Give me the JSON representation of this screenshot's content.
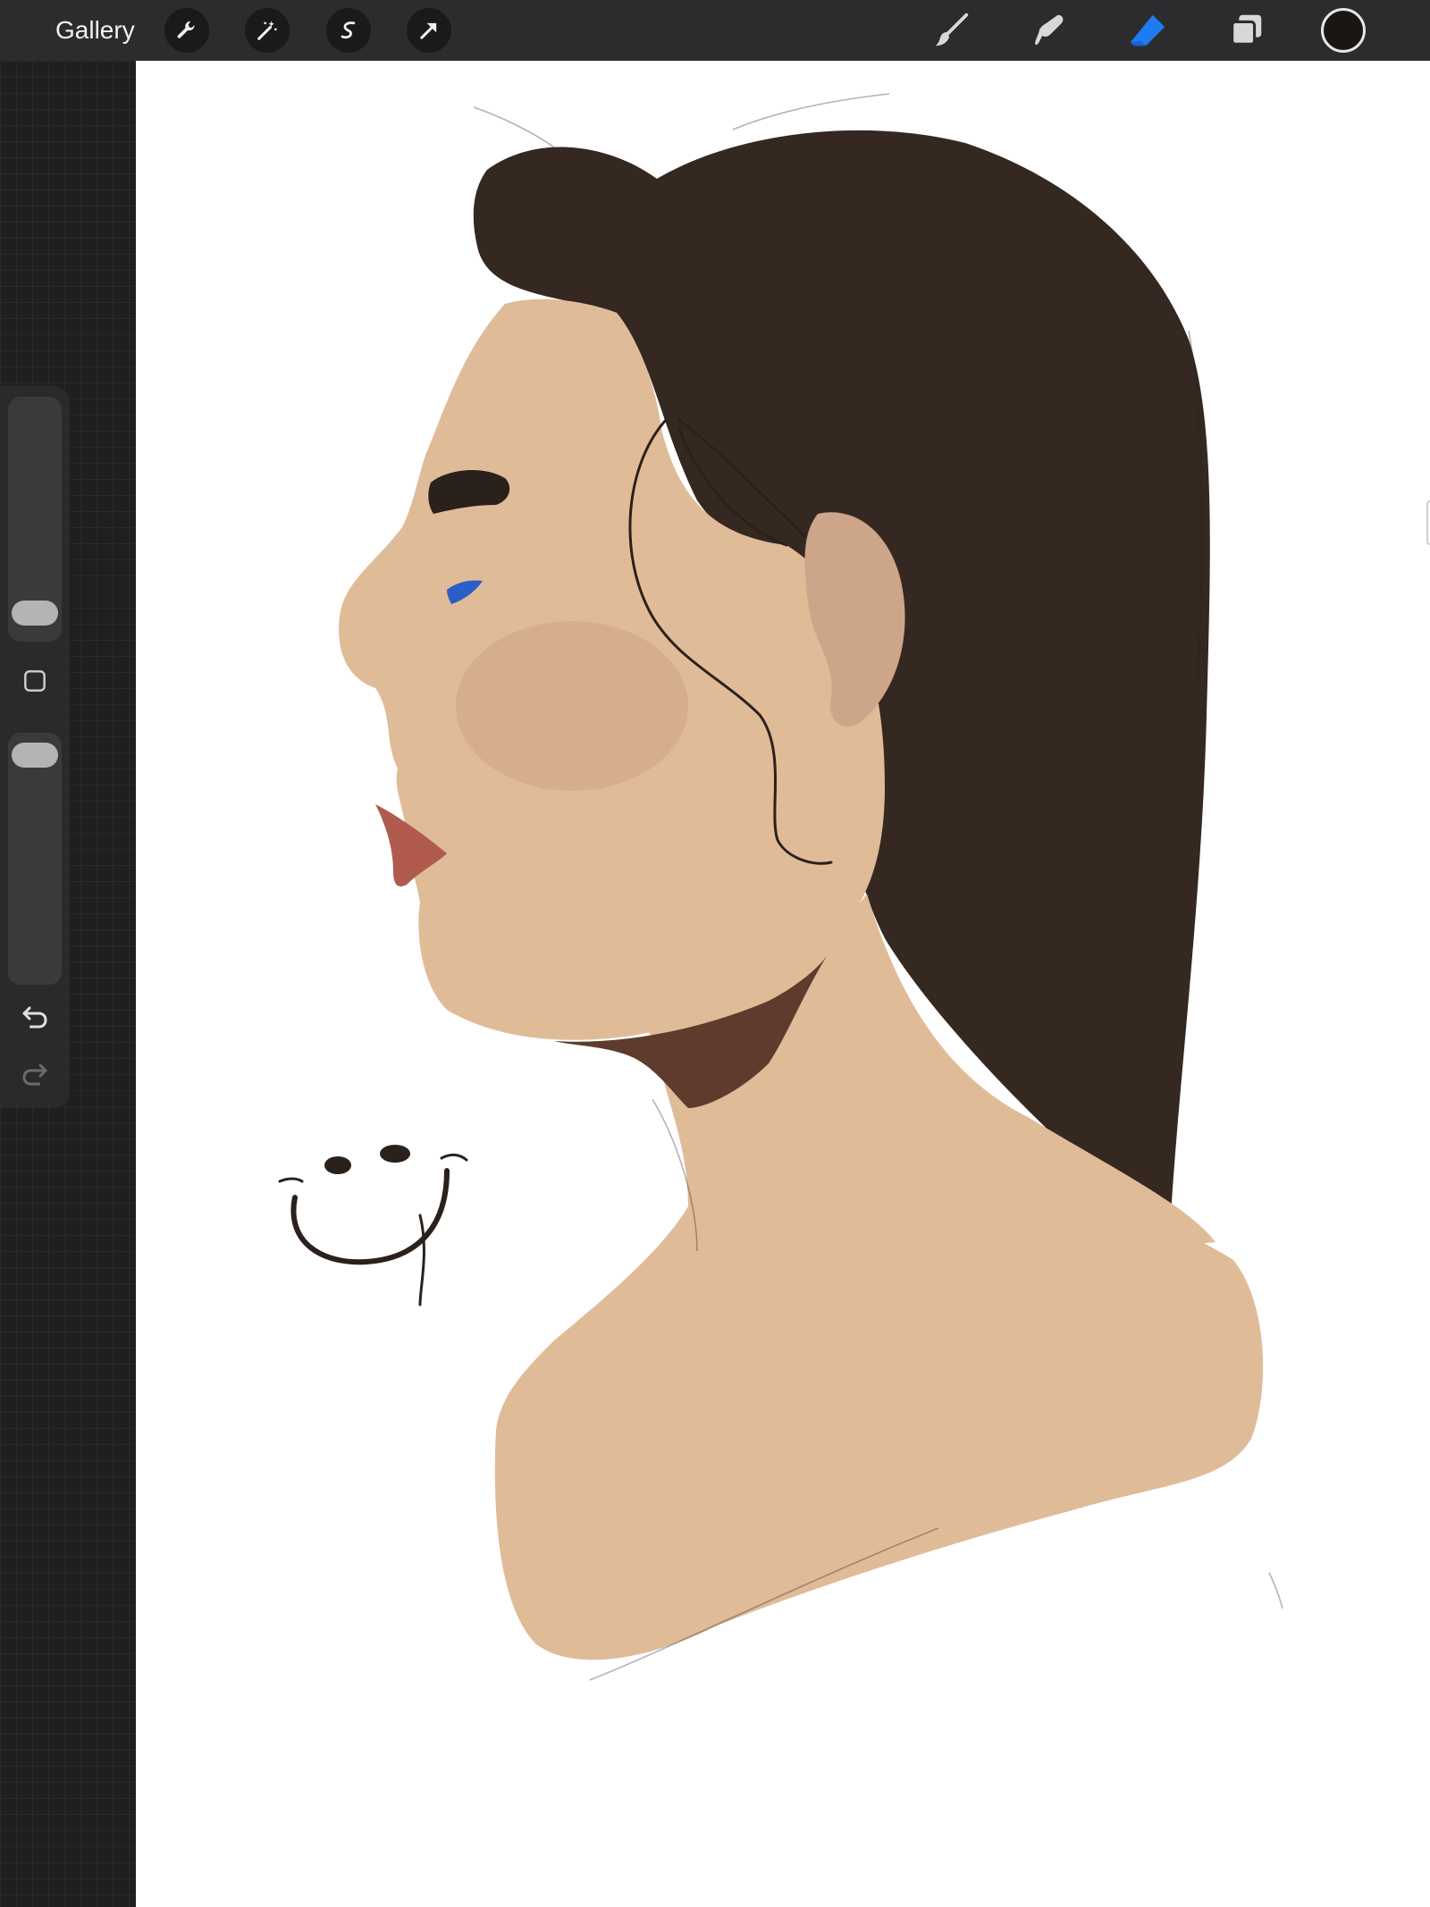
{
  "toolbar": {
    "gallery_label": "Gallery",
    "left_tools": [
      {
        "icon": "wrench-icon"
      },
      {
        "icon": "magic-wand-icon"
      },
      {
        "icon": "selection-icon"
      },
      {
        "icon": "transform-arrow-icon"
      }
    ],
    "right_tools": [
      {
        "icon": "brush-icon"
      },
      {
        "icon": "smudge-icon"
      },
      {
        "icon": "eraser-icon",
        "active": true
      },
      {
        "icon": "layers-icon"
      }
    ],
    "current_color": "#1a1614",
    "active_tool_color": "#1e7cf2"
  },
  "sidebar": {
    "brush_size_level": 0.06,
    "opacity_level": 0.97
  },
  "canvas": {
    "background": "#ffffff",
    "colors": {
      "hair": "#342821",
      "skin": "#e0bb98",
      "shadow": "#5e3b2d",
      "lips": "#b05b4e",
      "ear": "#cda589",
      "blush": "#c9a081",
      "eye": "#2a5ec8",
      "line": "#2b211c"
    }
  }
}
